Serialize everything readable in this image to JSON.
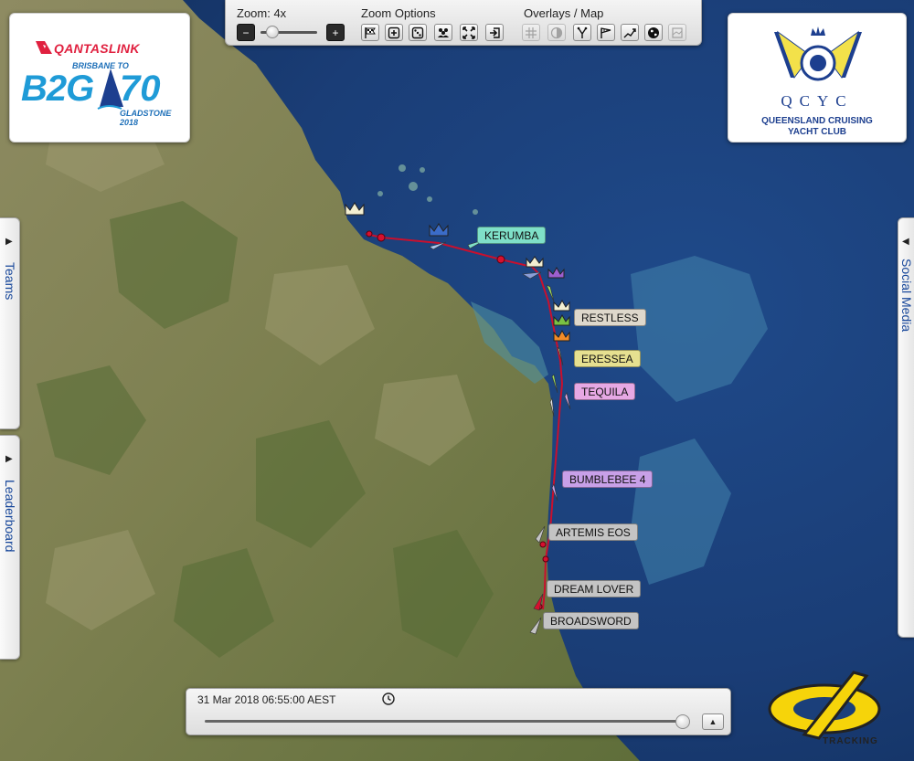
{
  "toolbar": {
    "zoom_label": "Zoom: 4x",
    "zoom_options_label": "Zoom Options",
    "overlays_label": "Overlays / Map",
    "zoom_out_symbol": "−",
    "zoom_in_symbol": "+"
  },
  "logos": {
    "left": {
      "brand": "QANTASLINK",
      "line_top": "BRISBANE TO",
      "b2g": "B2G",
      "number": "70",
      "line_bottom": "GLADSTONE 2018"
    },
    "right": {
      "letters": "QCYC",
      "name_line1": "QUEENSLAND CRUISING",
      "name_line2": "YACHT CLUB"
    }
  },
  "side_tabs": {
    "teams": "Teams",
    "leaderboard": "Leaderboard",
    "social": "Social Media"
  },
  "boats": [
    {
      "name": "KERUMBA",
      "color": "#7fe0c8"
    },
    {
      "name": "RESTLESS",
      "color": "#ded8cc"
    },
    {
      "name": "ERESSEA",
      "color": "#e6e090"
    },
    {
      "name": "TEQUILA",
      "color": "#e6a8e4"
    },
    {
      "name": "BUMBLEBEE 4",
      "color": "#c8a0e8"
    },
    {
      "name": "ARTEMIS EOS",
      "color": "#c4c4c4"
    },
    {
      "name": "DREAM LOVER",
      "color": "#c4c4c4"
    },
    {
      "name": "BROADSWORD",
      "color": "#c4c4c4"
    }
  ],
  "timeline": {
    "datetime": "31 Mar 2018 06:55:00 AEST",
    "play_symbol": "▲"
  },
  "branding": {
    "tracking": "TRACKING"
  },
  "icons": [
    "minus-icon",
    "plus-icon",
    "flag-icon",
    "zoom-in-icon",
    "dice-icon",
    "group-icon",
    "fit-icon",
    "exit-icon",
    "grid-icon",
    "contrast-icon",
    "route-icon",
    "wind-icon",
    "tracks-icon",
    "globe-icon",
    "map-icon",
    "clock-icon",
    "play-icon"
  ],
  "colors": {
    "track": "#c8102e",
    "label_text": "#16469a",
    "ocean": "#1b3f7a"
  }
}
